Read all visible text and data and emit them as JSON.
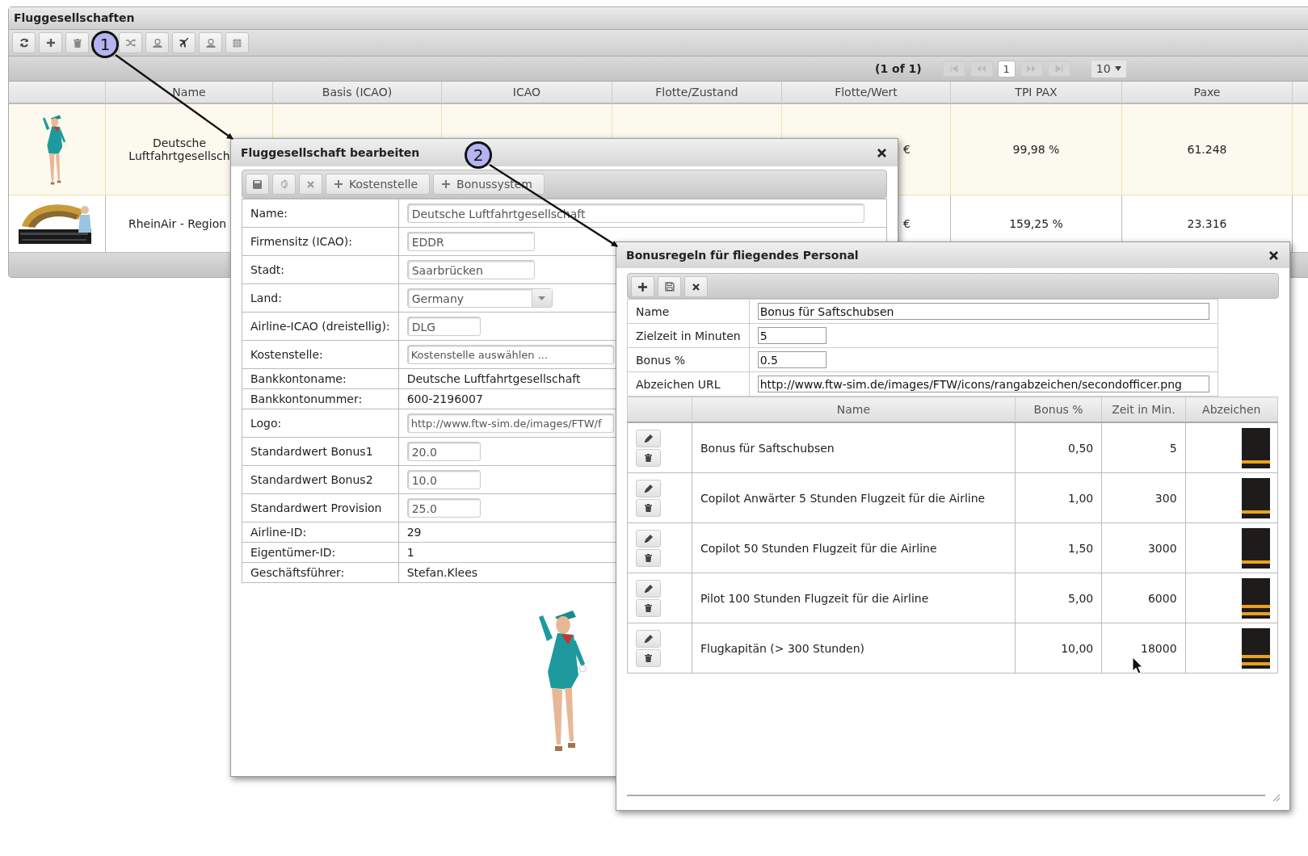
{
  "panel": {
    "title": "Fluggesellschaften"
  },
  "pager": {
    "status": "(1 of 1)",
    "pages": [
      {
        "label": "1",
        "selected": true
      }
    ],
    "page_size": "10"
  },
  "table": {
    "columns": [
      "Name",
      "Basis (ICAO)",
      "ICAO",
      "Flotte/Zustand",
      "Flotte/Wert",
      "TPI PAX",
      "Paxe"
    ],
    "rows": [
      {
        "selected": true,
        "name": "Deutsche Luftfahrtgesellsch",
        "flotte_wert": "€",
        "tpi_pax": "99,98 %",
        "paxe": "61.248"
      },
      {
        "selected": false,
        "name": "RheinAir - Region",
        "flotte_wert": "€",
        "tpi_pax": "159,25 %",
        "paxe": "23.316"
      }
    ]
  },
  "edit_dialog": {
    "title": "Fluggesellschaft bearbeiten",
    "toolbar": [
      "Kostenstelle",
      "Bonussystem"
    ],
    "fields": [
      {
        "label": "Name:",
        "kind": "input",
        "value": "Deutsche Luftfahrtgesellschaft"
      },
      {
        "label": "Firmensitz (ICAO):",
        "kind": "input",
        "value": "EDDR"
      },
      {
        "label": "Stadt:",
        "kind": "input",
        "value": "Saarbrücken"
      },
      {
        "label": "Land:",
        "kind": "select",
        "value": "Germany"
      },
      {
        "label": "Airline-ICAO (dreistellig):",
        "kind": "input",
        "value": "DLG"
      },
      {
        "label": "Kostenstelle:",
        "kind": "input",
        "placeholder": "Kostenstelle auswählen ..."
      },
      {
        "label": "Bankkontoname:",
        "kind": "text",
        "value": "Deutsche Luftfahrtgesellschaft"
      },
      {
        "label": "Bankkontonummer:",
        "kind": "text",
        "value": "600-2196007"
      },
      {
        "label": "Logo:",
        "kind": "input",
        "value": "http://www.ftw-sim.de/images/FTW/f"
      },
      {
        "label": "Standardwert Bonus1",
        "kind": "input",
        "value": "20.0"
      },
      {
        "label": "Standardwert Bonus2",
        "kind": "input",
        "value": "10.0"
      },
      {
        "label": "Standardwert Provision",
        "kind": "input",
        "value": "25.0"
      },
      {
        "label": "Airline-ID:",
        "kind": "text",
        "value": "29"
      },
      {
        "label": "Eigentümer-ID:",
        "kind": "text",
        "value": "1"
      },
      {
        "label": "Geschäftsführer:",
        "kind": "text",
        "value": "Stefan.Klees"
      }
    ]
  },
  "bonus_dialog": {
    "title": "Bonusregeln für fliegendes Personal",
    "form": [
      {
        "label": "Name",
        "value": "Bonus für Saftschubsen"
      },
      {
        "label": "Zielzeit in Minuten",
        "value": "5"
      },
      {
        "label": "Bonus %",
        "value": "0.5"
      },
      {
        "label": "Abzeichen URL",
        "value": "http://www.ftw-sim.de/images/FTW/icons/rangabzeichen/secondofficer.png"
      }
    ],
    "grid": {
      "columns": [
        "Name",
        "Bonus %",
        "Zeit in Min.",
        "Abzeichen"
      ],
      "rows": [
        {
          "name": "Bonus für Saftschubsen",
          "bonus": "0,50",
          "time": "5",
          "kind": "single"
        },
        {
          "name": "Copilot Anwärter 5 Stunden Flugzeit für die Airline",
          "bonus": "1,00",
          "time": "300",
          "kind": "single"
        },
        {
          "name": "Copilot 50 Stunden Flugzeit für die Airline",
          "bonus": "1,50",
          "time": "3000",
          "kind": "single"
        },
        {
          "name": "Pilot 100 Stunden Flugzeit für die Airline",
          "bonus": "5,00",
          "time": "6000",
          "kind": "double"
        },
        {
          "name": "Flugkapitän (> 300 Stunden)",
          "bonus": "10,00",
          "time": "18000",
          "kind": "double"
        }
      ]
    }
  },
  "annotations": [
    {
      "label": "1"
    },
    {
      "label": "2"
    }
  ]
}
